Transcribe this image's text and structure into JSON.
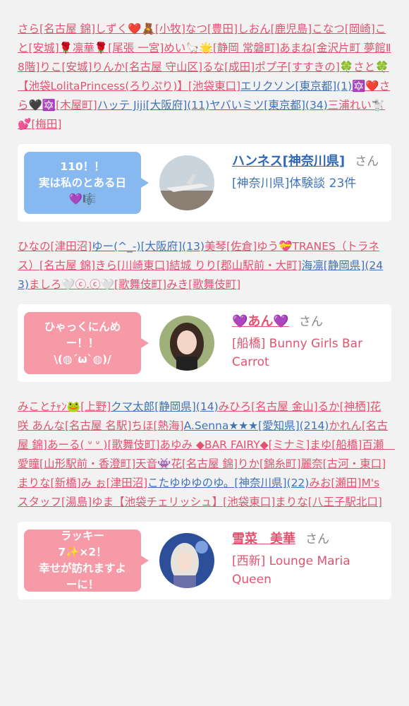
{
  "block1": [
    {
      "t": "さら",
      "c": "pink"
    },
    {
      "t": "[名古屋 錦]",
      "c": "pink"
    },
    {
      "t": "しずく❤️🧸",
      "c": "pink"
    },
    {
      "t": "[小牧]",
      "c": "pink"
    },
    {
      "t": "なつ",
      "c": "pink"
    },
    {
      "t": "[豊田]",
      "c": "pink"
    },
    {
      "t": "しおん",
      "c": "pink"
    },
    {
      "t": "[鹿児島]",
      "c": "pink"
    },
    {
      "t": "こなつ",
      "c": "pink"
    },
    {
      "t": "[岡崎]",
      "c": "pink"
    },
    {
      "t": "こと",
      "c": "pink"
    },
    {
      "t": "[安城]",
      "c": "pink"
    },
    {
      "t": "🌹凛華🌹",
      "c": "pink"
    },
    {
      "t": "[尾張 一宮]",
      "c": "pink"
    },
    {
      "t": "めい🦙🌟",
      "c": "pink"
    },
    {
      "t": "[静岡 常磐町]",
      "c": "pink"
    },
    {
      "t": "あまね",
      "c": "pink"
    },
    {
      "t": "[金沢片町 夢館Ⅱ8階]",
      "c": "pink"
    },
    {
      "t": "りこ",
      "c": "pink"
    },
    {
      "t": "[安城]",
      "c": "pink"
    },
    {
      "t": "りんか",
      "c": "pink"
    },
    {
      "t": "[名古屋 守山区]",
      "c": "pink"
    },
    {
      "t": "るな",
      "c": "pink"
    },
    {
      "t": "[成田]",
      "c": "pink"
    },
    {
      "t": "ポプ子",
      "c": "pink"
    },
    {
      "t": "[すすきの]",
      "c": "pink"
    },
    {
      "t": "🍀さと🍀",
      "c": "pink"
    },
    {
      "t": "【池袋LolitaPrincess(ろりぷり)】",
      "c": "pink"
    },
    {
      "t": "[池袋東口]",
      "c": "pink"
    },
    {
      "t": "エリクソン",
      "c": "blue"
    },
    {
      "t": "[東京都]",
      "c": "blue"
    },
    {
      "t": "(1)",
      "c": "blue"
    },
    {
      "t": "🔯❤️さら🖤🔯",
      "c": "pink"
    },
    {
      "t": "[木屋町]",
      "c": "pink"
    },
    {
      "t": "ハッテ Jiji",
      "c": "blue"
    },
    {
      "t": "[大阪府]",
      "c": "blue"
    },
    {
      "t": "(11)",
      "c": "blue"
    },
    {
      "t": "ヤバいミツ",
      "c": "blue"
    },
    {
      "t": "[東京都]",
      "c": "blue"
    },
    {
      "t": "(34)",
      "c": "blue"
    },
    {
      "t": "三浦れい🐩💕",
      "c": "pink"
    },
    {
      "t": "[梅田]",
      "c": "pink"
    }
  ],
  "card1": {
    "bubble": [
      "110！！",
      "実は私のとある日",
      "💜🎼"
    ],
    "name": "ハンネス[神奈川県]",
    "san": "さん",
    "shop": "[神奈川県]体験談 23件"
  },
  "block2": [
    {
      "t": "ひなの",
      "c": "pink"
    },
    {
      "t": "[津田沼]",
      "c": "pink"
    },
    {
      "t": "ゆー(^_-)",
      "c": "blue"
    },
    {
      "t": "[大阪府]",
      "c": "blue"
    },
    {
      "t": "(13)",
      "c": "blue"
    },
    {
      "t": "美琴",
      "c": "pink"
    },
    {
      "t": "[佐倉]",
      "c": "pink"
    },
    {
      "t": "ゆう💝TRANES（トラネス）",
      "c": "pink"
    },
    {
      "t": "[名古屋 錦]",
      "c": "pink"
    },
    {
      "t": "きら",
      "c": "pink"
    },
    {
      "t": "[川崎東口]",
      "c": "pink"
    },
    {
      "t": "結城 りり",
      "c": "pink"
    },
    {
      "t": "[郡山駅前・大町]",
      "c": "pink"
    },
    {
      "t": "海凛",
      "c": "blue"
    },
    {
      "t": "[静岡県]",
      "c": "blue"
    },
    {
      "t": "(243)",
      "c": "blue"
    },
    {
      "t": "ましろ🤍ⓒ.ⓒ🤍",
      "c": "pink"
    },
    {
      "t": "[歌舞伎町]",
      "c": "pink"
    },
    {
      "t": "みき",
      "c": "pink"
    },
    {
      "t": "[歌舞伎町]",
      "c": "pink"
    }
  ],
  "card2": {
    "bubble": [
      "ひゃっくにんめ",
      "ー！！",
      "\\(◍´ω`◍)/"
    ],
    "name": "💜あん💜",
    "san": "さん",
    "shop": "[船橋] Bunny Girls Bar Carrot"
  },
  "block3": [
    {
      "t": "みことﾁｬﾝ🐸",
      "c": "pink"
    },
    {
      "t": "[上野]",
      "c": "pink"
    },
    {
      "t": "クマ太郎",
      "c": "blue"
    },
    {
      "t": "[静岡県]",
      "c": "blue"
    },
    {
      "t": "(14)",
      "c": "blue"
    },
    {
      "t": "みひろ",
      "c": "pink"
    },
    {
      "t": "[名古屋 金山]",
      "c": "pink"
    },
    {
      "t": "るか",
      "c": "pink"
    },
    {
      "t": "[神栖]",
      "c": "pink"
    },
    {
      "t": "花咲 あんな",
      "c": "pink"
    },
    {
      "t": "[名古屋 名駅]",
      "c": "pink"
    },
    {
      "t": "ちほ",
      "c": "pink"
    },
    {
      "t": "[熱海]",
      "c": "pink"
    },
    {
      "t": "A.Senna★★★",
      "c": "blue"
    },
    {
      "t": "[愛知県]",
      "c": "blue"
    },
    {
      "t": "(214)",
      "c": "blue"
    },
    {
      "t": "かれん",
      "c": "pink"
    },
    {
      "t": "[名古屋 錦]",
      "c": "pink"
    },
    {
      "t": "あーる( ᐡ ᐡ )",
      "c": "pink"
    },
    {
      "t": "[歌舞伎町]",
      "c": "pink"
    },
    {
      "t": "あゆみ ◆BAR FAIRY◆",
      "c": "pink"
    },
    {
      "t": "[ミナミ]",
      "c": "pink"
    },
    {
      "t": "まゆ",
      "c": "pink"
    },
    {
      "t": "[船橋]",
      "c": "pink"
    },
    {
      "t": "百瀬　愛瞳",
      "c": "pink"
    },
    {
      "t": "[山形駅前・香澄町]",
      "c": "pink"
    },
    {
      "t": "天音👾",
      "c": "pink"
    },
    {
      "t": "花",
      "c": "pink"
    },
    {
      "t": "[名古屋 錦]",
      "c": "pink"
    },
    {
      "t": "りか",
      "c": "pink"
    },
    {
      "t": "[錦糸町]",
      "c": "pink"
    },
    {
      "t": "麗奈",
      "c": "pink"
    },
    {
      "t": "[古河・東口]",
      "c": "pink"
    },
    {
      "t": "まりな",
      "c": "pink"
    },
    {
      "t": "[新橋]",
      "c": "pink"
    },
    {
      "t": "み ぉ",
      "c": "pink"
    },
    {
      "t": "[津田沼]",
      "c": "pink"
    },
    {
      "t": "こたゆゆゆのゆ。",
      "c": "blue"
    },
    {
      "t": "[神奈川県]",
      "c": "blue"
    },
    {
      "t": "(22)",
      "c": "blue"
    },
    {
      "t": "みお",
      "c": "pink"
    },
    {
      "t": "[瀬田]",
      "c": "pink"
    },
    {
      "t": "M's スタッフ",
      "c": "pink"
    },
    {
      "t": "[湯島]",
      "c": "pink"
    },
    {
      "t": "ゆま【池袋チェリッシュ】",
      "c": "pink"
    },
    {
      "t": "[池袋東口]",
      "c": "pink"
    },
    {
      "t": "まりな",
      "c": "pink"
    },
    {
      "t": "[八王子駅北口]",
      "c": "pink"
    }
  ],
  "card3": {
    "bubble": [
      "ラッキー",
      "7✨×2！",
      "幸せが訪れますよ",
      "ーに！"
    ],
    "name": "雪菜　美華",
    "san": "さん",
    "shop": "[西新] Lounge Maria Queen"
  },
  "colors": {
    "pink": "#e2536f",
    "blue": "#3f73b8",
    "bubble_blue": "#87b8f0",
    "bubble_pink": "#f79aa7"
  }
}
